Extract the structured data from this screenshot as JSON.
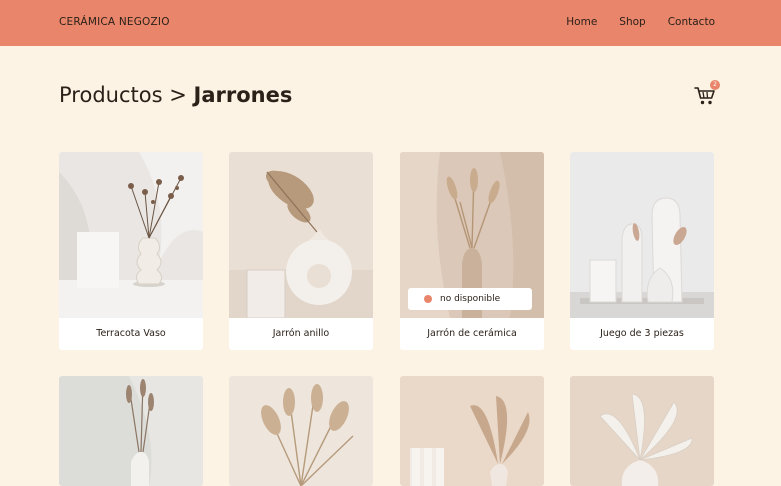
{
  "header": {
    "brand": "CERÁMICA NEGOZIO",
    "nav": [
      "Home",
      "Shop",
      "Contacto"
    ]
  },
  "breadcrumb": {
    "parent": "Productos",
    "separator": ">",
    "current": "Jarrones"
  },
  "cart": {
    "icon": "cart-icon",
    "count": "2"
  },
  "products": [
    {
      "name": "Terracota Vaso"
    },
    {
      "name": "Jarrón anillo"
    },
    {
      "name": "Jarrón de cerámica",
      "status": "no disponible"
    },
    {
      "name": "Juego de 3 piezas"
    }
  ],
  "colors": {
    "header": "#e8856a",
    "background": "#fdf3e4",
    "accent": "#e8856a"
  }
}
